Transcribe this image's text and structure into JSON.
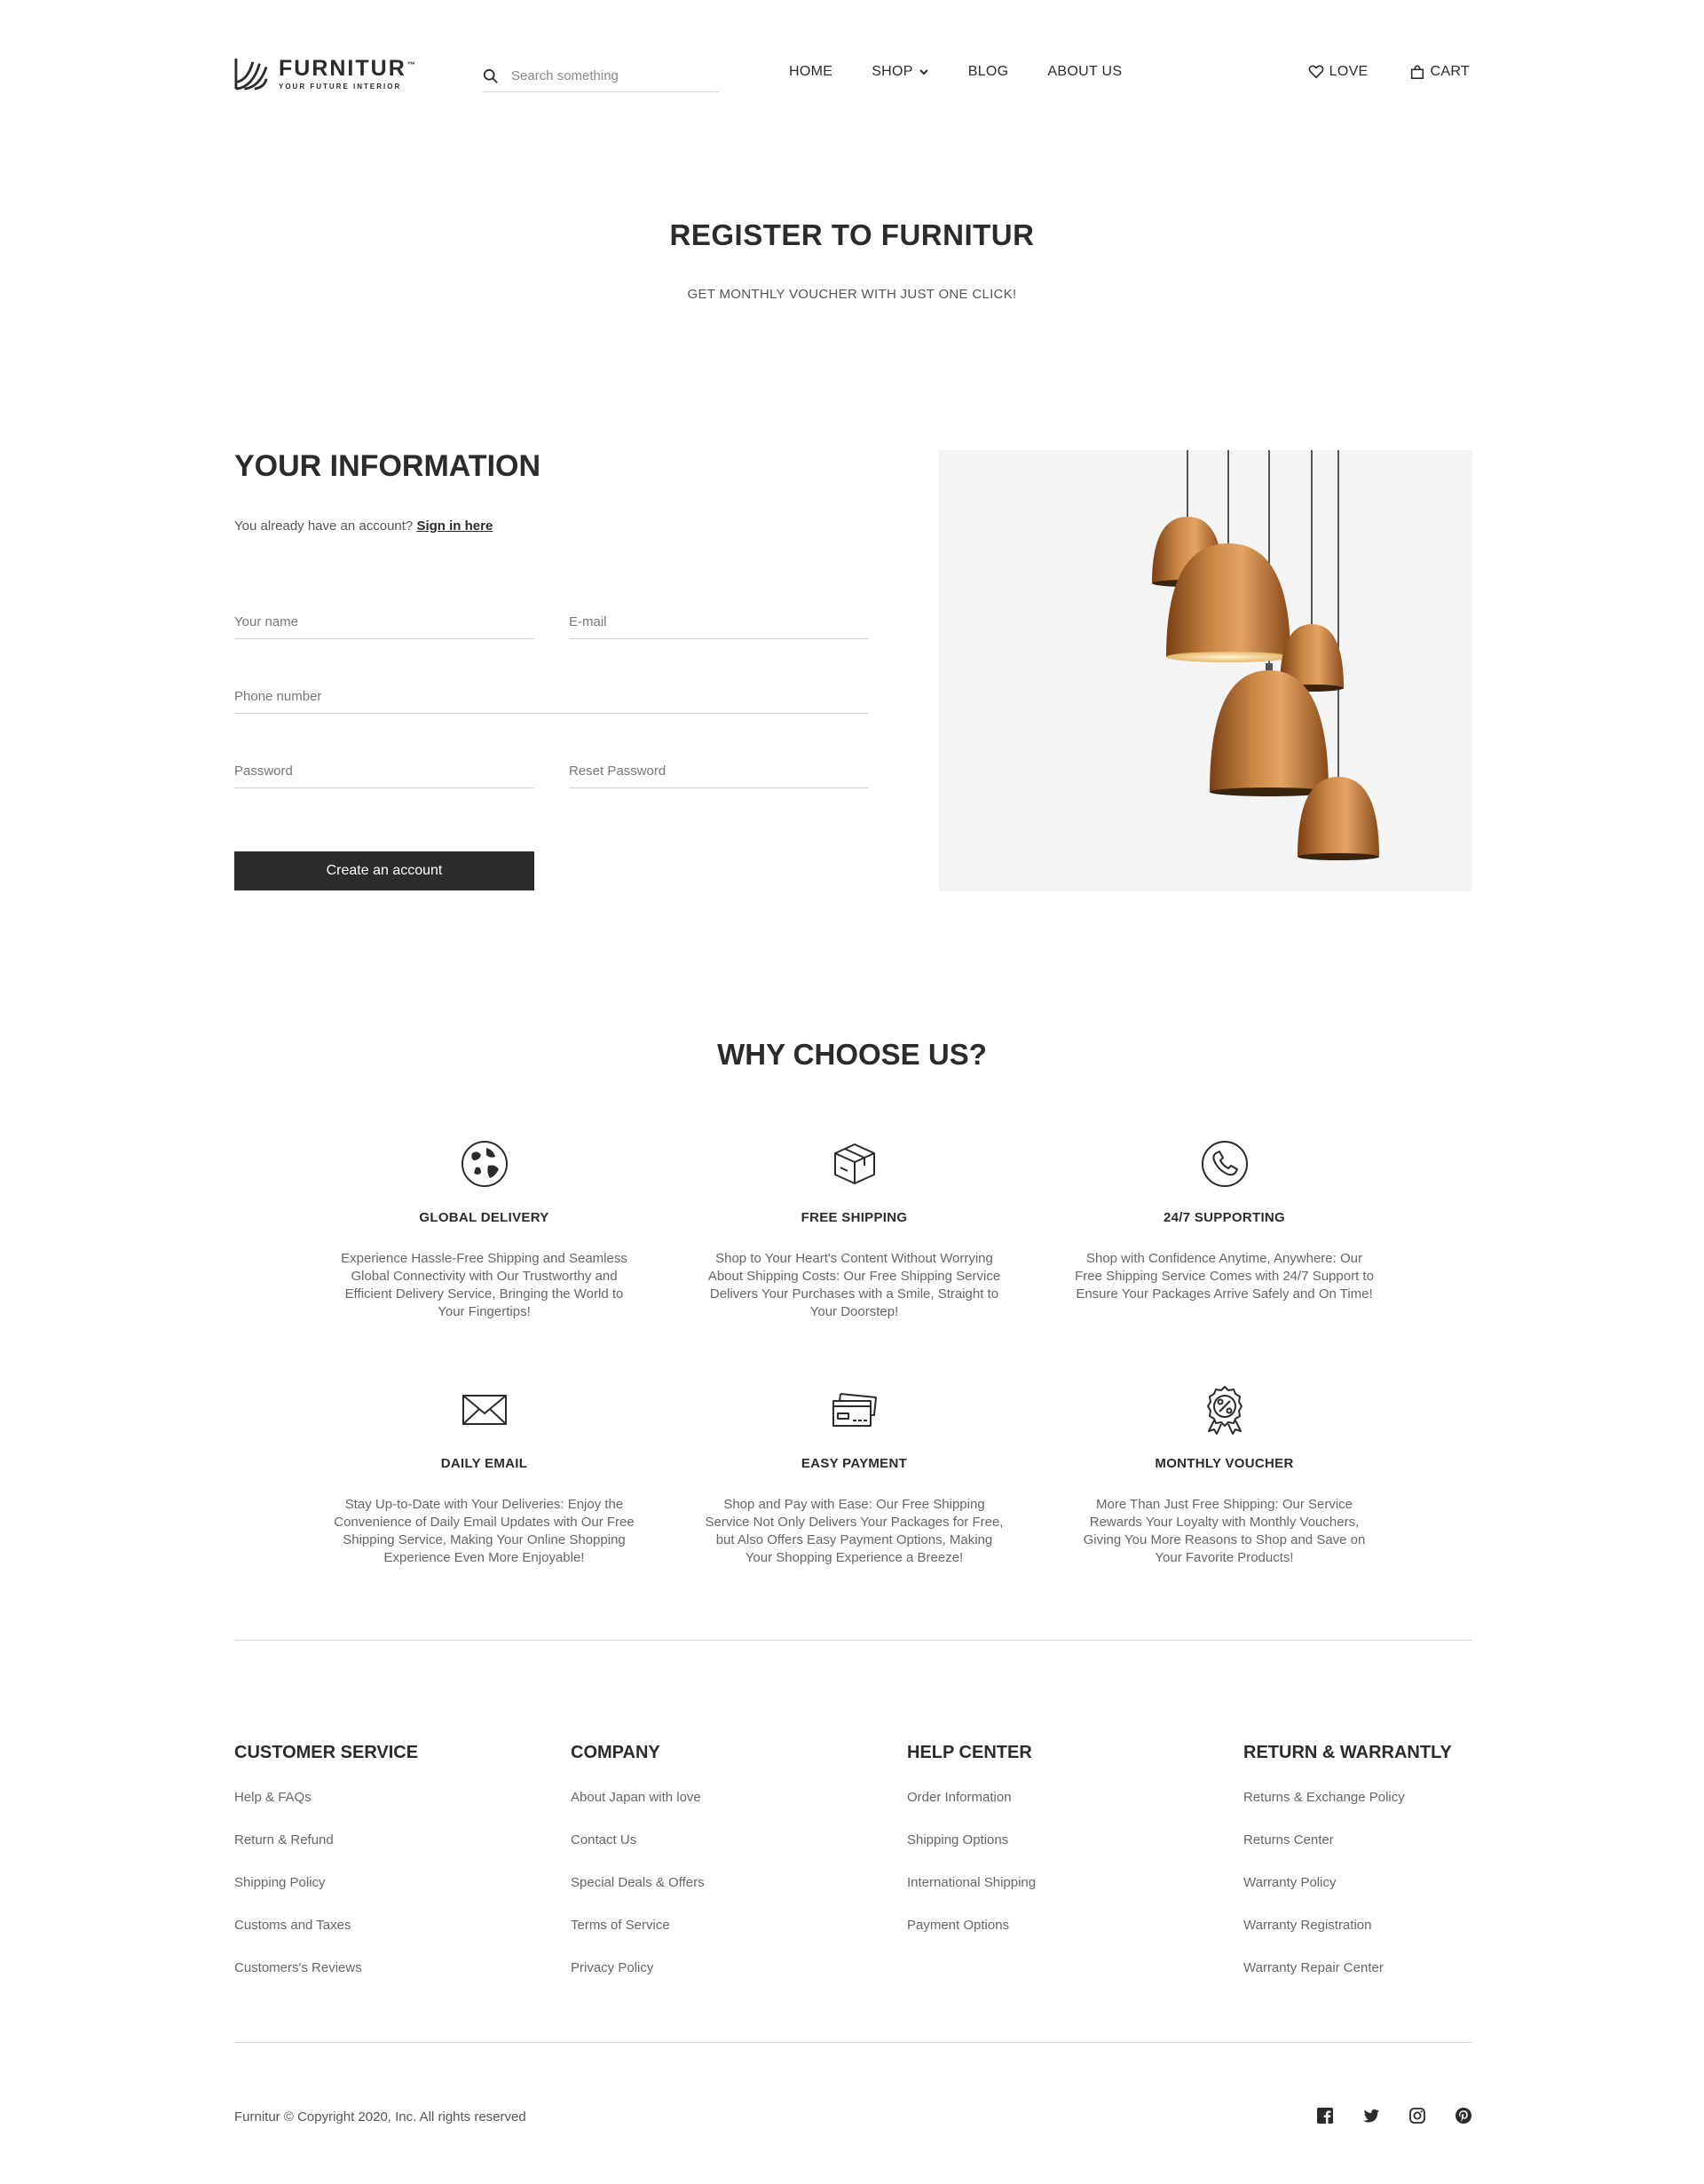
{
  "header": {
    "logo_name": "FURNITUR",
    "logo_tm": "™",
    "logo_tagline": "YOUR FUTURE INTERIOR",
    "search_placeholder": "Search something",
    "nav": {
      "home": "HOME",
      "shop": "SHOP",
      "blog": "BLOG",
      "about": "ABOUT US"
    },
    "love": "LOVE",
    "cart": "CART"
  },
  "hero": {
    "title": "REGISTER TO FURNITUR",
    "subtitle": "GET MONTHLY VOUCHER WITH JUST ONE CLICK!"
  },
  "form": {
    "title": "YOUR INFORMATION",
    "account_prompt": "You already have an account?",
    "sign_in_link": "Sign in here",
    "name_placeholder": "Your name",
    "email_placeholder": "E-mail",
    "phone_placeholder": "Phone number",
    "password_placeholder": "Password",
    "reset_password_placeholder": "Reset Password",
    "submit_label": "Create an account"
  },
  "why": {
    "title": "WHY CHOOSE US?",
    "features": [
      {
        "icon": "globe-icon",
        "title": "GLOBAL DELIVERY",
        "desc": "Experience Hassle-Free Shipping and Seamless Global Connectivity with Our Trustworthy and Efficient Delivery Service, Bringing the World to Your Fingertips!"
      },
      {
        "icon": "box-icon",
        "title": "FREE SHIPPING",
        "desc": "Shop to Your Heart's Content Without Worrying About Shipping Costs: Our Free Shipping Service Delivers Your Purchases with a Smile, Straight to Your Doorstep!"
      },
      {
        "icon": "phone-icon",
        "title": "24/7 SUPPORTING",
        "desc": "Shop with Confidence Anytime, Anywhere: Our Free Shipping Service Comes with 24/7 Support to Ensure Your Packages Arrive Safely and On Time!"
      },
      {
        "icon": "envelope-icon",
        "title": "DAILY EMAIL",
        "desc": "Stay Up-to-Date with Your Deliveries: Enjoy the Convenience of Daily Email Updates with Our Free Shipping Service, Making Your Online Shopping Experience Even More Enjoyable!"
      },
      {
        "icon": "credit-card-icon",
        "title": "EASY PAYMENT",
        "desc": "Shop and Pay with Ease: Our Free Shipping Service Not Only Delivers Your Packages for Free, but Also Offers Easy Payment Options, Making Your Shopping Experience a Breeze!"
      },
      {
        "icon": "voucher-badge-icon",
        "title": "MONTHLY  VOUCHER",
        "desc": "More Than Just Free Shipping: Our Service Rewards Your Loyalty with Monthly Vouchers, Giving You More Reasons to Shop and Save on Your Favorite Products!"
      }
    ]
  },
  "footer": {
    "columns": [
      {
        "title": "CUSTOMER SERVICE",
        "links": [
          "Help & FAQs",
          "Return & Refund",
          "Shipping Policy",
          "Customs and Taxes",
          "Customers's Reviews"
        ]
      },
      {
        "title": "COMPANY",
        "links": [
          "About Japan with love",
          "Contact Us",
          "Special Deals & Offers",
          "Terms of Service",
          "Privacy Policy"
        ]
      },
      {
        "title": "HELP CENTER",
        "links": [
          "Order Information",
          "Shipping Options",
          "International Shipping",
          "Payment Options"
        ]
      },
      {
        "title": "RETURN & WARRANTLY",
        "links": [
          "Returns & Exchange Policy",
          "Returns Center",
          "Warranty Policy",
          "Warranty Registration",
          "Warranty Repair Center"
        ]
      }
    ],
    "copyright": "Furnitur © Copyright 2020, Inc. All rights reserved",
    "socials": [
      "facebook-icon",
      "twitter-icon",
      "instagram-icon",
      "pinterest-icon"
    ]
  },
  "colors": {
    "text_dark": "#2b2b2b",
    "text_muted": "#666666",
    "button_bg": "#2b2b2b",
    "image_bg": "#f4f4f4",
    "lamp_copper": "#b86f2e"
  }
}
